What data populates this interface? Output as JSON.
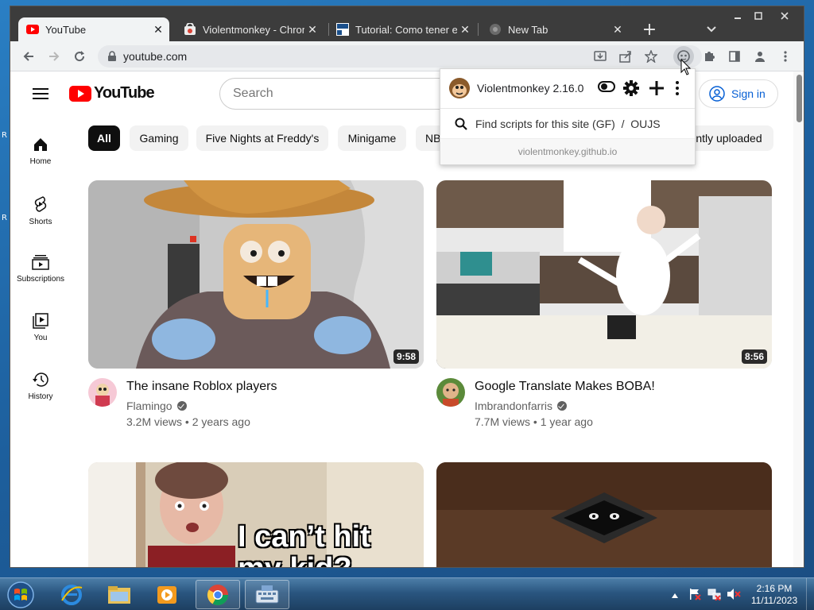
{
  "browser": {
    "tabs": [
      {
        "title": "YouTube",
        "close": "✕",
        "active": true
      },
      {
        "title": "Violentmonkey - Chrom",
        "close": "✕",
        "active": false
      },
      {
        "title": "Tutorial: Como tener el t",
        "close": "✕",
        "active": false
      },
      {
        "title": "New Tab",
        "close": "✕",
        "active": false
      }
    ],
    "new_tab": "+",
    "url": "youtube.com"
  },
  "youtube": {
    "logo_text": "YouTube",
    "search_placeholder": "Search",
    "sign_in": "Sign in",
    "guide": [
      {
        "label": "Home",
        "icon": "home-icon"
      },
      {
        "label": "Shorts",
        "icon": "shorts-icon"
      },
      {
        "label": "Subscriptions",
        "icon": "subscriptions-icon"
      },
      {
        "label": "You",
        "icon": "you-icon"
      },
      {
        "label": "History",
        "icon": "history-icon"
      }
    ],
    "chips": [
      "All",
      "Gaming",
      "Five Nights at Freddy's",
      "Minigame",
      "NB",
      "ntly uploaded"
    ],
    "videos": [
      {
        "title": "The insane Roblox players",
        "channel": "Flamingo",
        "meta": "3.2M views • 2 years ago",
        "duration": "9:58",
        "verified": true
      },
      {
        "title": "Google Translate Makes BOBA!",
        "channel": "Imbrandonfarris",
        "meta": "7.7M views • 1 year ago",
        "duration": "8:56",
        "verified": true
      },
      {
        "thumb_caption_1": "I can’t hit",
        "thumb_caption_2": "my kid?"
      },
      {}
    ]
  },
  "violentmonkey": {
    "title": "Violentmonkey 2.16.0",
    "find_scripts": "Find scripts for this site (GF)  /  OUJS",
    "footer": "violentmonkey.github.io"
  },
  "desktop": {
    "left_glyph_1": "R",
    "left_glyph_2": "R"
  },
  "taskbar": {
    "clock_time": "2:16 PM",
    "clock_date": "11/11/2023"
  },
  "colors": {
    "youtube_red": "#ff0000",
    "accent_blue": "#065fd4",
    "chrome_dark": "#3c3c3c"
  }
}
